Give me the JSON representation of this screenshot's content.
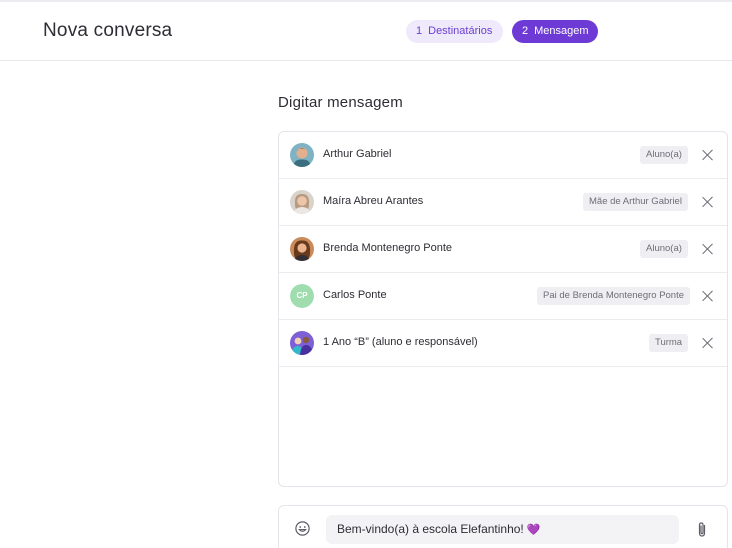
{
  "header": {
    "title": "Nova conversa",
    "steps": [
      {
        "number": "1",
        "label": "Destinatários",
        "state": "inactive"
      },
      {
        "number": "2",
        "label": "Mensagem",
        "state": "active"
      }
    ]
  },
  "main": {
    "section_title": "Digitar mensagem",
    "recipients": [
      {
        "name": "Arthur Gabriel",
        "tag": "Aluno(a)",
        "avatar": "photo-boy-icon"
      },
      {
        "name": "Maíra Abreu Arantes",
        "tag": "Mãe de Arthur Gabriel",
        "avatar": "photo-woman-icon"
      },
      {
        "name": "Brenda Montenegro Ponte",
        "tag": "Aluno(a)",
        "avatar": "photo-girl-icon"
      },
      {
        "name": "Carlos Ponte",
        "tag": "Pai de Brenda Montenegro Ponte",
        "avatar_initials": "CP"
      },
      {
        "name": "1 Ano “B” (aluno e responsável)",
        "tag": "Turma",
        "avatar": "class-group-icon"
      }
    ]
  },
  "composer": {
    "message": "Bem-vindo(a) à escola Elefantinho!",
    "message_emoji": "💜",
    "emoji_icon": "smiley-icon",
    "attach_icon": "paperclip-icon"
  },
  "colors": {
    "accent": "#6d3ad6",
    "accent_light": "#eee9fb",
    "initials_avatar": "#9fdcae"
  }
}
